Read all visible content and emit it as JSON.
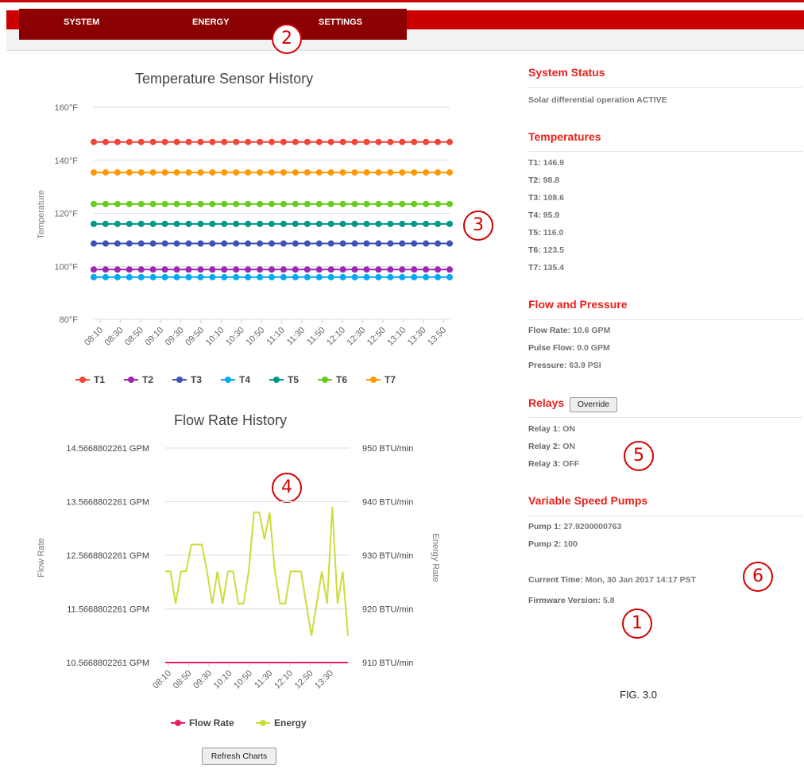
{
  "nav": {
    "items": [
      "SYSTEM",
      "ENERGY",
      "SETTINGS"
    ]
  },
  "callouts": [
    "1",
    "2",
    "3",
    "4",
    "5",
    "6"
  ],
  "colors": {
    "accent": "#cc0000",
    "nav_bg": "#8b0000",
    "heading": "#e8201a"
  },
  "temp_chart": {
    "title": "Temperature Sensor History",
    "ylabel": "Temperature",
    "yticks": [
      "80°F",
      "100°F",
      "120°F",
      "140°F",
      "160°F"
    ],
    "xticks": [
      "08:10",
      "08:30",
      "08:50",
      "09:10",
      "09:30",
      "09:50",
      "10:10",
      "10:30",
      "10:50",
      "11:10",
      "11:30",
      "11:50",
      "12:10",
      "12:30",
      "12:50",
      "13:10",
      "13:30",
      "13:50"
    ]
  },
  "flow_chart": {
    "title": "Flow Rate History",
    "ylabel_left": "Flow Rate",
    "ylabel_right": "Energy Rate",
    "yticks_left": [
      "10.5668802261 GPM",
      "11.5668802261 GPM",
      "12.5668802261 GPM",
      "13.5668802261 GPM",
      "14.5668802261 GPM"
    ],
    "yticks_right": [
      "910 BTU/min",
      "920 BTU/min",
      "930 BTU/min",
      "940 BTU/min",
      "950 BTU/min"
    ],
    "xticks": [
      "08:10",
      "08:50",
      "09:30",
      "10:10",
      "10:50",
      "11:30",
      "12:10",
      "12:50",
      "13:30"
    ]
  },
  "chart_data": [
    {
      "type": "line",
      "title": "Temperature Sensor History",
      "ylabel": "Temperature",
      "ylim": [
        80,
        160
      ],
      "points_per_series": 31,
      "series": [
        {
          "name": "T1",
          "value": 146.9,
          "color": "#f0453a"
        },
        {
          "name": "T2",
          "value": 98.8,
          "color": "#9c27b0"
        },
        {
          "name": "T3",
          "value": 108.6,
          "color": "#3f51b5"
        },
        {
          "name": "T4",
          "value": 95.9,
          "color": "#03a9f4"
        },
        {
          "name": "T5",
          "value": 116.0,
          "color": "#009688"
        },
        {
          "name": "T6",
          "value": 123.5,
          "color": "#66cc1e"
        },
        {
          "name": "T7",
          "value": 135.4,
          "color": "#ff9800"
        }
      ]
    },
    {
      "type": "line",
      "title": "Flow Rate History",
      "ylabel_left": "Flow Rate",
      "ylabel_right": "Energy Rate",
      "ylim_left": [
        10.5668802261,
        14.5668802261
      ],
      "ylim_right": [
        910,
        950
      ],
      "series": [
        {
          "name": "Flow Rate",
          "axis": "left",
          "color": "#e91e63",
          "values": [
            10.5668802261,
            10.5668802261,
            10.5668802261,
            10.5668802261,
            10.5668802261,
            10.5668802261,
            10.5668802261,
            10.5668802261,
            10.5668802261,
            10.5668802261,
            10.5668802261,
            10.5668802261,
            10.5668802261,
            10.5668802261,
            10.5668802261,
            10.5668802261,
            10.5668802261,
            10.5668802261,
            10.5668802261,
            10.5668802261,
            10.5668802261,
            10.5668802261,
            10.5668802261,
            10.5668802261,
            10.5668802261,
            10.5668802261,
            10.5668802261,
            10.5668802261,
            10.5668802261,
            10.5668802261,
            10.5668802261,
            10.5668802261,
            10.5668802261,
            10.5668802261,
            10.5668802261,
            10.5668802261
          ]
        },
        {
          "name": "Energy",
          "axis": "right",
          "color": "#cddc39",
          "values": [
            927,
            927,
            921,
            927,
            927,
            932,
            932,
            932,
            927,
            921,
            927,
            921,
            927,
            927,
            921,
            921,
            927,
            938,
            938,
            933,
            938,
            927,
            921,
            921,
            927,
            927,
            927,
            921,
            915,
            921,
            927,
            921,
            939,
            921,
            927,
            915
          ]
        }
      ]
    }
  ],
  "status": {
    "heading": "System Status",
    "text": "Solar differential operation ACTIVE"
  },
  "temperatures": {
    "heading": "Temperatures",
    "items": [
      {
        "k": "T1:",
        "v": "146.9"
      },
      {
        "k": "T2:",
        "v": "98.8"
      },
      {
        "k": "T3:",
        "v": "108.6"
      },
      {
        "k": "T4:",
        "v": "95.9"
      },
      {
        "k": "T5:",
        "v": "116.0"
      },
      {
        "k": "T6:",
        "v": "123.5"
      },
      {
        "k": "T7:",
        "v": "135.4"
      }
    ]
  },
  "flow": {
    "heading": "Flow and Pressure",
    "items": [
      {
        "k": "Flow Rate:",
        "v": "10.6 GPM"
      },
      {
        "k": "Pulse Flow:",
        "v": "0.0 GPM"
      },
      {
        "k": "Pressure:",
        "v": "63.9 PSI"
      }
    ]
  },
  "relays": {
    "heading": "Relays",
    "override_label": "Override",
    "items": [
      {
        "k": "Relay 1:",
        "v": "ON"
      },
      {
        "k": "Relay 2:",
        "v": "ON"
      },
      {
        "k": "Relay 3:",
        "v": "OFF"
      }
    ]
  },
  "pumps": {
    "heading": "Variable Speed Pumps",
    "items": [
      {
        "k": "Pump 1:",
        "v": "27.9200000763"
      },
      {
        "k": "Pump 2:",
        "v": "100"
      }
    ]
  },
  "footer": {
    "time_label": "Current Time:",
    "time_value": "Mon, 30 Jan 2017 14:17 PST",
    "fw_label": "Firmware Version:",
    "fw_value": "5.8",
    "refresh_label": "Refresh Charts",
    "figure_label": "FIG. 3.0"
  }
}
